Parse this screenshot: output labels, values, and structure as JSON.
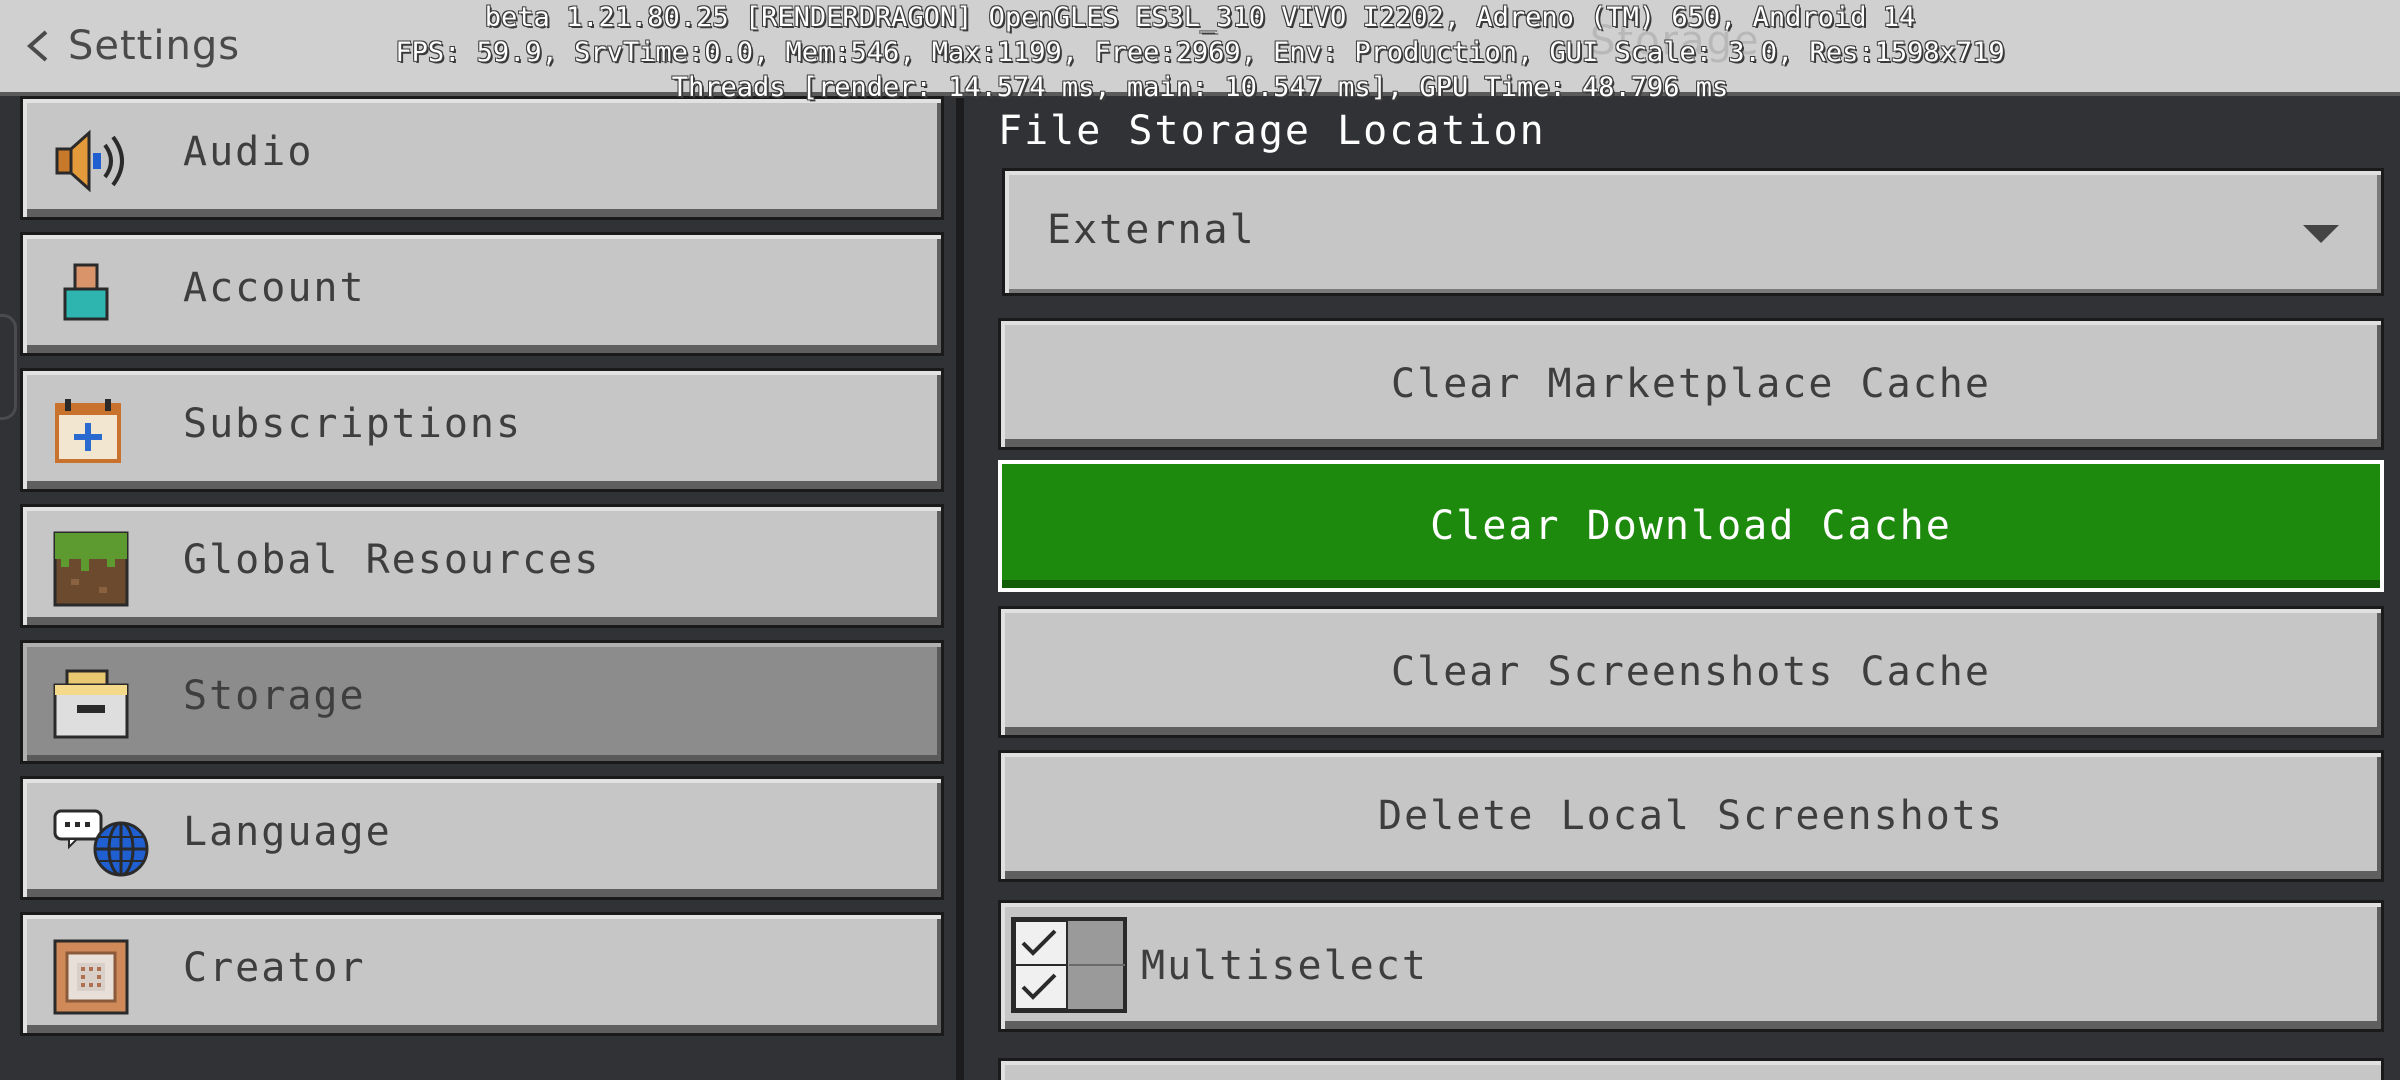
{
  "header": {
    "back_label": "Settings",
    "title": "Storage",
    "debug_lines": [
      "beta 1.21.80.25 [RENDERDRAGON] OpenGLES ES3L_310 VIVO I2202, Adreno (TM) 650, Android 14",
      "FPS: 59.9, SrvTime:0.0, Mem:546, Max:1199, Free:2969, Env: Production, GUI Scale: 3.0, Res:1598x719",
      "Threads [render: 14.574 ms, main: 10.547 ms], GPU Time: 48.796 ms"
    ]
  },
  "sidebar": {
    "items": [
      {
        "label": "Audio",
        "icon": "speaker-icon",
        "selected": false
      },
      {
        "label": "Account",
        "icon": "account-icon",
        "selected": false
      },
      {
        "label": "Subscriptions",
        "icon": "calendar-plus-icon",
        "selected": false
      },
      {
        "label": "Global Resources",
        "icon": "grass-block-icon",
        "selected": false
      },
      {
        "label": "Storage",
        "icon": "folder-drawer-icon",
        "selected": true
      },
      {
        "label": "Language",
        "icon": "chat-globe-icon",
        "selected": false
      },
      {
        "label": "Creator",
        "icon": "command-block-icon",
        "selected": false
      }
    ]
  },
  "main": {
    "file_storage_label": "File Storage Location",
    "storage_location": {
      "value": "External",
      "options": [
        "External"
      ]
    },
    "buttons": {
      "clear_marketplace": "Clear Marketplace Cache",
      "clear_download": "Clear Download Cache",
      "clear_screenshots": "Clear Screenshots Cache",
      "delete_screenshots": "Delete Local Screenshots"
    },
    "multiselect": {
      "label": "Multiselect",
      "checked": true
    }
  },
  "colors": {
    "primary_green": "#1d8a0d",
    "button_gray": "#c6c6c6",
    "selected_gray": "#8c8c8c",
    "background": "#313236"
  }
}
